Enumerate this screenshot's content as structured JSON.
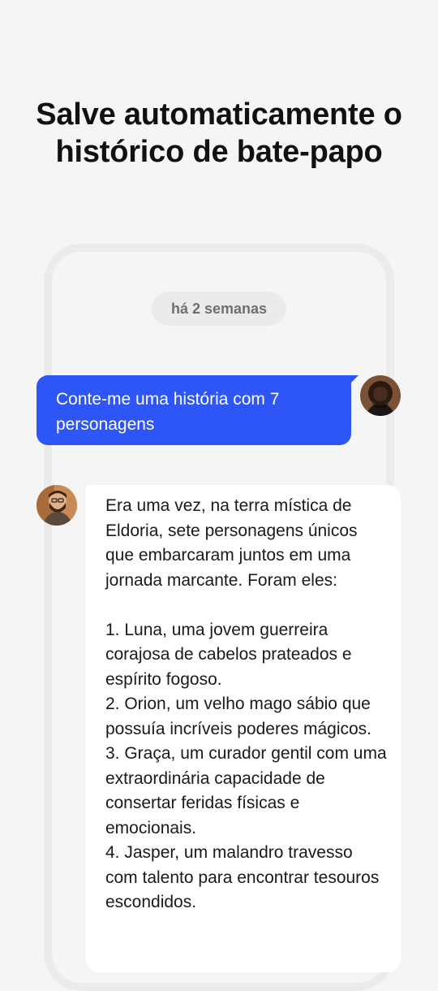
{
  "headline": {
    "line1": "Salve automaticamente o",
    "line2": "histórico de bate-papo"
  },
  "chat": {
    "timestamp": "há 2 semanas",
    "user_message": "Conte-me uma história com 7 personagens",
    "assistant_message": "Era uma vez, na terra mística de Eldoria, sete personagens únicos que embarcaram juntos em uma jornada marcante. Foram eles:\n\n1. Luna, uma jovem guerreira corajosa de cabelos prateados e espírito fogoso.\n2. Orion, um velho mago sábio que possuía incríveis poderes mágicos.\n3. Graça, um curador gentil com uma extraordinária capacidade de consertar feridas físicas e emocionais.\n4. Jasper, um malandro travesso com talento para encontrar tesouros escondidos."
  },
  "colors": {
    "background": "#f5f5f5",
    "user_bubble": "#2e55f5",
    "assistant_bubble": "#ffffff",
    "pill": "#ebebeb",
    "phone_frame": "#ebebeb"
  }
}
